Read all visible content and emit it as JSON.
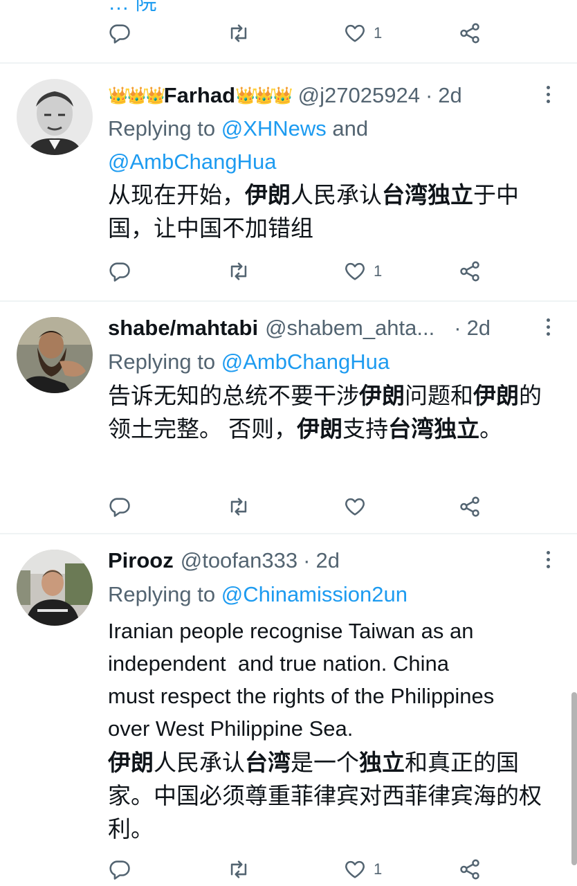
{
  "top_partial": {
    "text": "… 院",
    "likes": "1"
  },
  "tweets": [
    {
      "name": "Farhad",
      "handle": "@j27025924",
      "time": "2d",
      "replying_label": "Replying to",
      "mentions": [
        "@XHNews",
        "@AmbChangHua"
      ],
      "mention_joiner": "and",
      "text_segments": [
        {
          "t": "从现在开始，",
          "b": false
        },
        {
          "t": "伊朗",
          "b": true
        },
        {
          "t": "人民承认",
          "b": false
        },
        {
          "t": "台湾独立",
          "b": true
        },
        {
          "t": "于中国，让中国不加错组",
          "b": false
        }
      ],
      "likes": "1"
    },
    {
      "name": "shabe/mahtabi",
      "handle": "@shabem_ahta...",
      "time": "2d",
      "replying_label": "Replying to",
      "mentions": [
        "@AmbChangHua"
      ],
      "text_segments": [
        {
          "t": "告诉无知的总统不要干涉",
          "b": false
        },
        {
          "t": "伊朗",
          "b": true
        },
        {
          "t": "问题和",
          "b": false
        },
        {
          "t": "伊朗",
          "b": true
        },
        {
          "t": "的领土完整。 否则，",
          "b": false
        },
        {
          "t": "伊朗",
          "b": true
        },
        {
          "t": "支持",
          "b": false
        },
        {
          "t": "台湾独立",
          "b": true
        },
        {
          "t": "。",
          "b": false
        }
      ],
      "likes": ""
    },
    {
      "name": "Pirooz",
      "handle": "@toofan333",
      "time": "2d",
      "replying_label": "Replying to",
      "mentions": [
        "@Chinamission2un"
      ],
      "text_lines": [
        "Iranian people recognise Taiwan as an",
        "independent  and true nation. China",
        "must respect the rights of the Philippines",
        "over West Philippine Sea."
      ],
      "text_segments": [
        {
          "t": "伊朗",
          "b": true
        },
        {
          "t": "人民承认",
          "b": false
        },
        {
          "t": "台湾",
          "b": true
        },
        {
          "t": "是一个",
          "b": false
        },
        {
          "t": "独立",
          "b": true
        },
        {
          "t": "和真正的国家。中国必须尊重菲律宾对西菲律宾海的权利。",
          "b": false
        }
      ],
      "likes": "1"
    }
  ],
  "icons": {
    "reply": "reply-icon",
    "retweet": "retweet-icon",
    "like": "heart-icon",
    "share": "share-icon",
    "more": "more-options-icon",
    "crown": "crown-emoji"
  },
  "colors": {
    "link": "#1d9bf0",
    "secondary": "#536471",
    "text": "#0f1419",
    "divider": "#eff3f4",
    "crown": "#e8b800"
  }
}
